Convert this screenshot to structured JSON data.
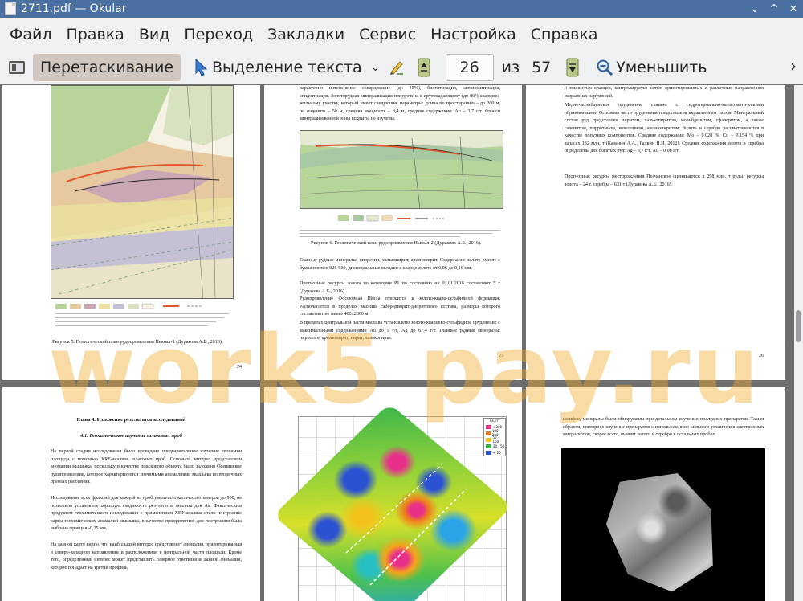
{
  "window": {
    "title": "2711.pdf  — Okular",
    "controls": [
      "⌄",
      "^",
      "✕"
    ]
  },
  "menu": [
    "Файл",
    "Правка",
    "Вид",
    "Переход",
    "Закладки",
    "Сервис",
    "Настройка",
    "Справка"
  ],
  "toolbar": {
    "browse_label": "Перетаскивание",
    "select_label": "Выделение текста",
    "dropdown_glyph": "⌄",
    "current_page": "26",
    "of_label": "из",
    "total_pages": "57",
    "zoom_out_label": "Уменьшить",
    "more_glyph": "›"
  },
  "pages": {
    "p24": {
      "caption": "Рисунок 5. Геологический план рудопроявления Ньюыл-1 (Дуракова А.Б., 2016).",
      "number": "24"
    },
    "p25": {
      "top_text": "характерно интенсивное окварцевание (до 45%), биотитизация, актинолитизация, эпидотизация. Золоторудная минерализация приурочена к крутопадающему (до 80°) кварцево-жильному участку, который имеет следующие параметры: длина по простиранию – до 200 м, по падению – 50 м, средняя мощность – 3,4 м, средние содержания: Au – 3,7 г/т. Фланги минерализованной зоны вскрыты не изучены.",
      "caption": "Рисунок 6. Геологический план рудопроявления Ньюыл-2 (Дуракова А.Б., 2016).",
      "body1": "Главные рудные минералы: пирротин, халькопирит, арсенопирит. Содержание золота вместе с бумажностью 926-930, дискоидальные вкладки в кварце золота от 0,06 до 0,16 мм.",
      "body2": "Прогнозные ресурсы золота по категории Р1 по состоянию на 01.01.2016 составляют 5 т (Дуракова А.Б., 2016).",
      "body3": "Рудопроявление Фосфорная Нёлда относится к золото-кварц-сульфидной формации. Располагается в пределах массива габбродиорит-диоритового состава, размеры которого составляют не менее 400х2000 м.",
      "body4": "В пределах центральной части массива установлено золото-кварцево-сульфидное оруденение с максимальными содержаниями Au до 5 г/т, Ag до 67,4 г/т. Главные рудные минералы: пирротин, арсенопирит, пирит, халькопирит.",
      "number": "25"
    },
    "p26": {
      "top_text": "и глинистых сланцев, контролируется сетью ориентированных и различных направлениях разрывных нарушений.",
      "body1": "Медно-молибденовое оруденение связано с гидротермально-метасоматическими образованиями. Основная часть оруденения представлена вкрапленным типом. Минеральный состав руд представлен пиритом, халькопиритом, молибденитом, сфалеритом, а также галенитом, пирротином, ковеллином, арсенопиритом. Золото и серебро рассматриваются в качестве попутных компонентов. Средние содержания: Mo – 0,028 %, Cu – 0,154 % при запасах 132 млн. т (Казанин А.А., Галкин Н.И, 2012). Средние содержания золота и серебра определены для богатых руд: Ag – 3,7 г/т, Au – 0,08 г/т.",
      "body2": "Прогнозные ресурсы месторождения Песчанское оцениваются в 298 млн. т руды, ресурсы золота – 24 т, серебра – 631 т (Дуракова А.Б., 2016).",
      "number": "26"
    },
    "p27": {
      "heading": "Глава 4. Изложение результатов исследований",
      "subheading": "4.1. Геохимическое изучение шлаковых проб",
      "body1": "На первой стадии исследования было проведено предварительное изучение геохимии площади с помощью XRF-анализа шлаковых проб. Основной интерес представляли аномалии мышьяка, поскольку в качестве поискового объекта было заложено Осенинское рудопроявление, которое характеризуется значимыми аномалиями мышьяка во вторичных ореолах рассеяния.",
      "body2": "Исследование всех фракций для каждой из проб увеличило количество замеров до 900, не позволило установить хорошую сходимость результатов анализа для As. Фактическим продуктом геохимического исследования с применением XRF-анализа стало построение карты геохимических аномалий мышьяка, в качестве приоритетной для построения была выбрана фракция -0,25 мм.",
      "body3": "На данной карте видно, что наибольший интерес представляет аномалия, ориентированная в северо-западном направлении и расположенная в центральной части площади. Кроме того, определенный интерес может представлять северное ответвление данной аномалии, которое попадает на третий профиль."
    },
    "p28": {
      "legend_title": "As, г/т",
      "legend_items": [
        ">200",
        "100 - 200",
        "50 - 100",
        "20 - 50",
        "< 20"
      ]
    },
    "p29": {
      "top_text": "шлифов, минералы были обнаружены при детальном изучении последних препаратов. Таким образом, повторное изучение препаратов с использованием сильного увеличения электронных микроскопов, скорее всего, выявит золото и серебро в остальных пробах."
    }
  },
  "watermark": "work5 pay.ru",
  "colors": {
    "titlebar": "#4a6fa1",
    "toolbar_bg": "#eff0f1",
    "doc_bg": "#6e6e6e",
    "active_tool": "#d3c8c0"
  }
}
